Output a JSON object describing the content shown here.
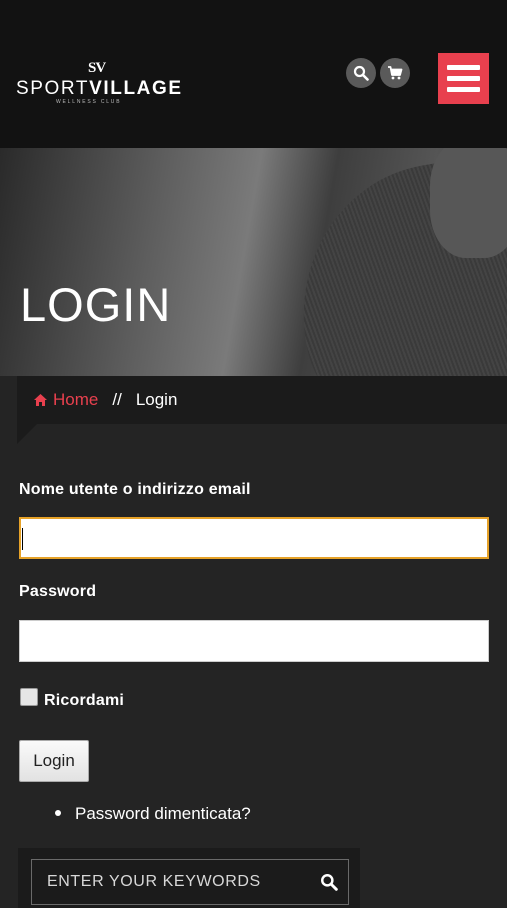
{
  "header": {
    "logo_monogram": "SV",
    "logo_word_light": "SPORT",
    "logo_word_bold": "VILLAGE",
    "logo_subtitle": "WELLNESS CLUB",
    "search_icon": "search-icon",
    "cart_icon": "cart-icon",
    "menu_icon": "hamburger-menu-icon",
    "menu_color": "#e8404e"
  },
  "hero": {
    "title": "LOGIN"
  },
  "breadcrumb": {
    "home_label": "Home",
    "home_icon": "home-icon",
    "separator": "//",
    "current": "Login",
    "accent": "#e8404e"
  },
  "form": {
    "username_label": "Nome utente o indirizzo email",
    "username_value": "",
    "password_label": "Password",
    "password_value": "",
    "remember_label": "Ricordami",
    "remember_checked": false,
    "submit_label": "Login",
    "forgot_link": "Password dimenticata?",
    "focus_color": "#e6a228"
  },
  "search_widget": {
    "placeholder": "ENTER YOUR KEYWORDS",
    "icon": "search-icon"
  }
}
